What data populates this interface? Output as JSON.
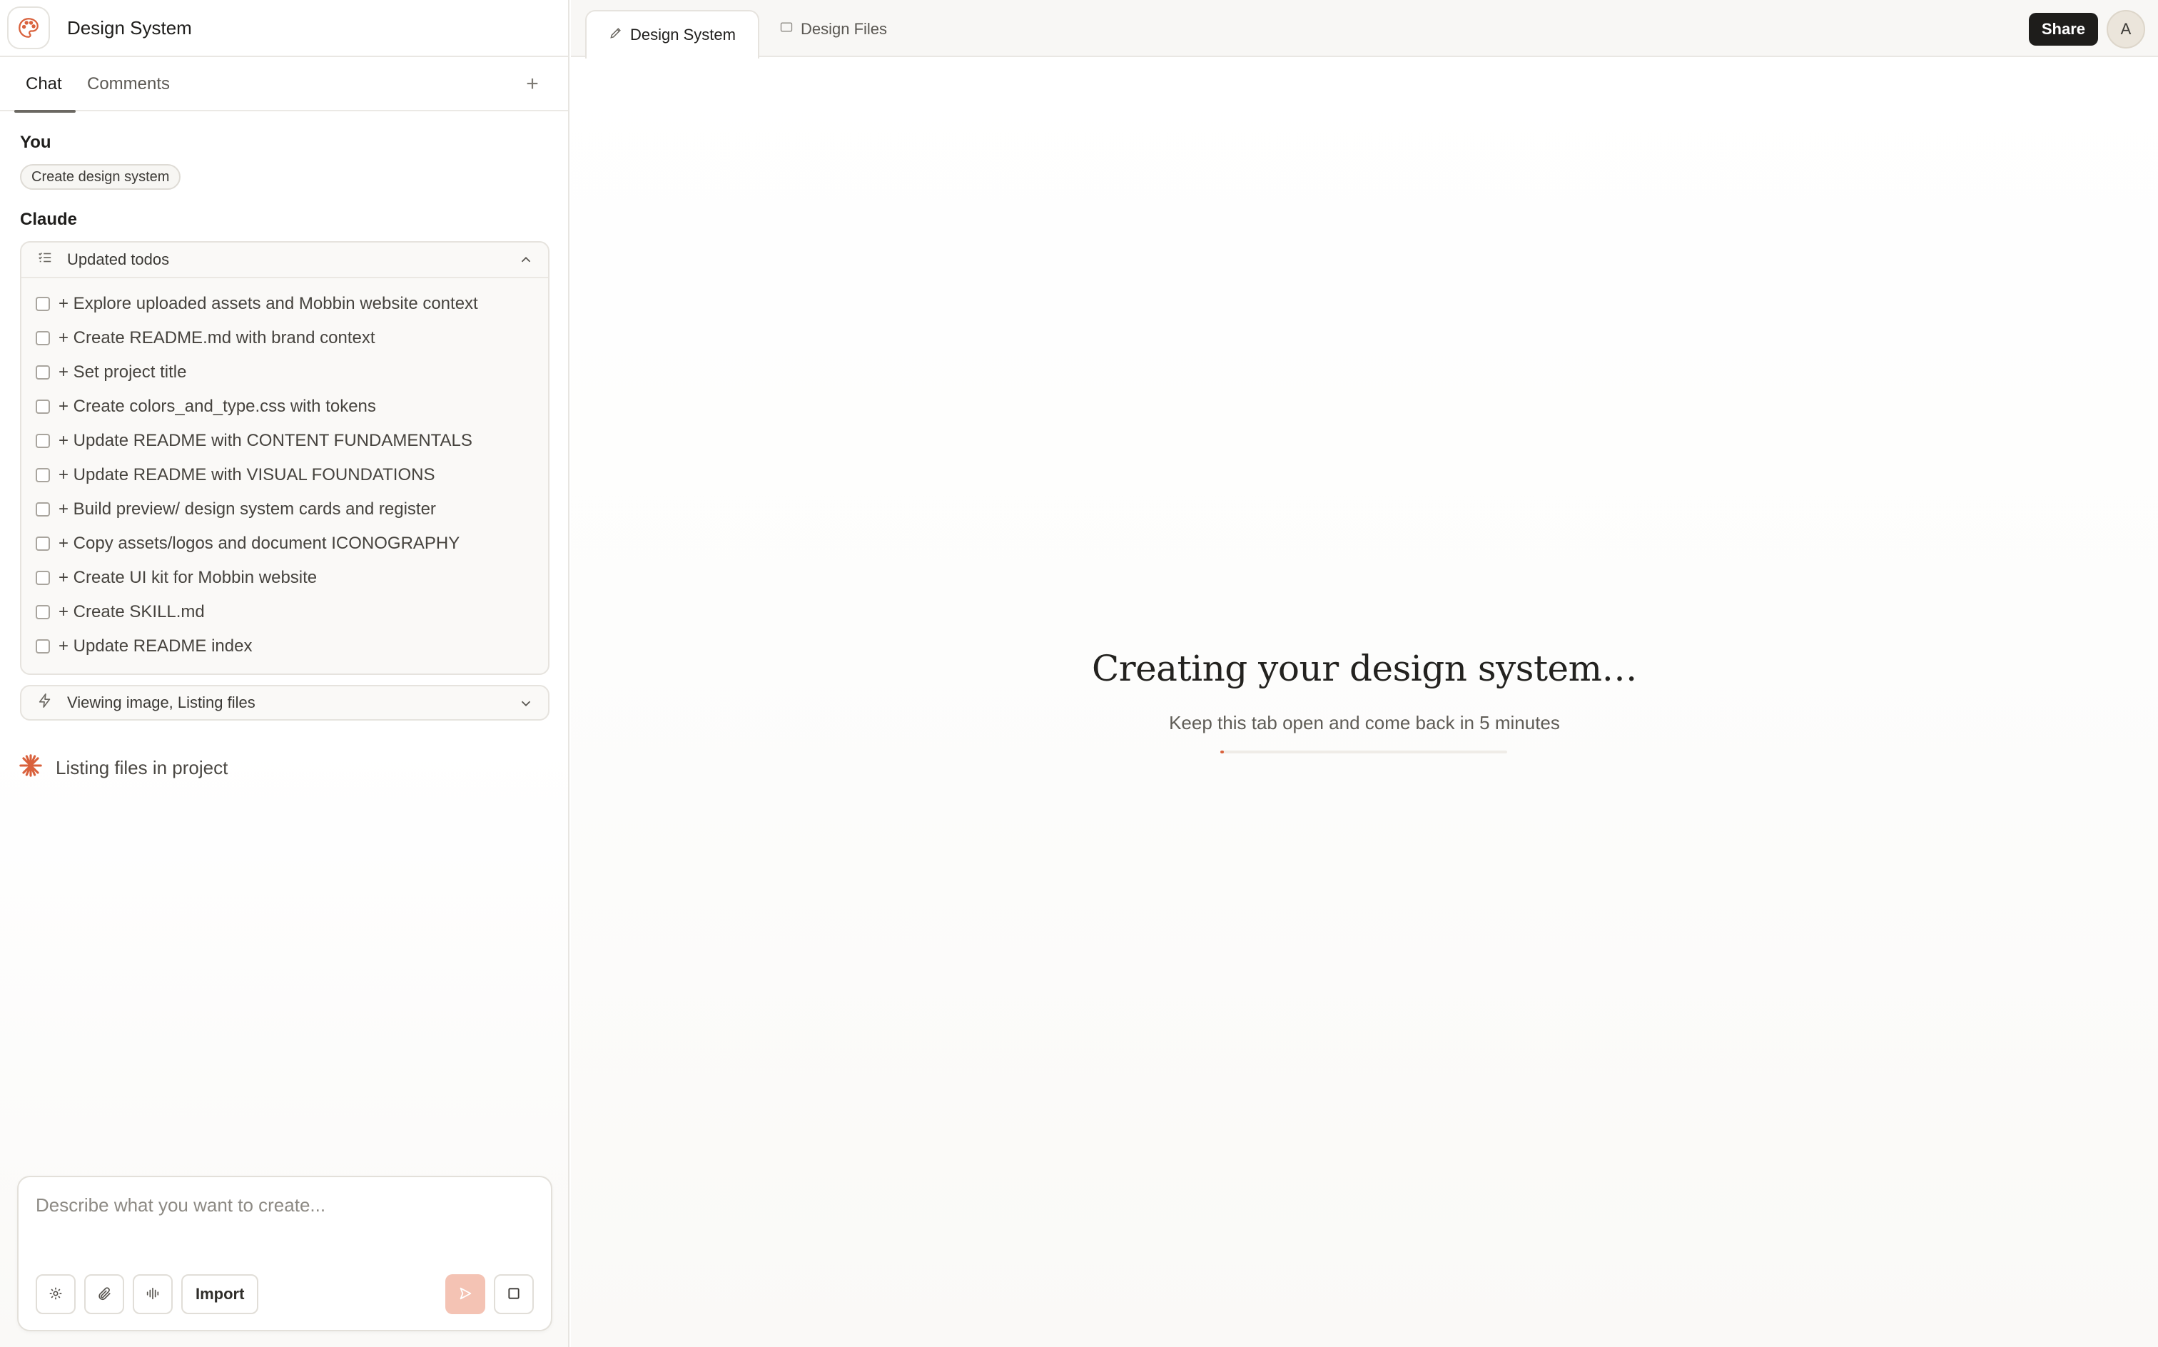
{
  "app": {
    "project_title": "Design System"
  },
  "sidebar": {
    "tabs": [
      {
        "label": "Chat",
        "active": true
      },
      {
        "label": "Comments",
        "active": false
      }
    ],
    "add_label": "+"
  },
  "conversation": {
    "user_label": "You",
    "user_prompt": "Create design system",
    "assistant_label": "Claude",
    "todos": {
      "header": "Updated todos",
      "items": [
        "+ Explore uploaded assets and Mobbin website context",
        "+ Create README.md with brand context",
        "+ Set project title",
        "+ Create colors_and_type.css with tokens",
        "+ Update README with CONTENT FUNDAMENTALS",
        "+ Update README with VISUAL FOUNDATIONS",
        "+ Build preview/ design system cards and register",
        "+ Copy assets/logos and document ICONOGRAPHY",
        "+ Create UI kit for Mobbin website",
        "+ Create SKILL.md",
        "+ Update README index"
      ]
    },
    "activity": "Viewing image, Listing files",
    "status": "Listing files in project"
  },
  "composer": {
    "placeholder": "Describe what you want to create...",
    "import_label": "Import"
  },
  "topbar": {
    "tabs": [
      {
        "label": "Design System",
        "icon": "pen-icon",
        "active": true
      },
      {
        "label": "Design Files",
        "icon": "folder-icon",
        "active": false
      }
    ],
    "share_label": "Share",
    "avatar_initial": "A"
  },
  "canvas": {
    "title": "Creating your design system…",
    "subtitle": "Keep this tab open and come back in 5 minutes",
    "progress": 0.012
  },
  "colors": {
    "accent": "#d9613c",
    "send_button": "#f4c3b4",
    "share_button": "#1e1d1b"
  }
}
